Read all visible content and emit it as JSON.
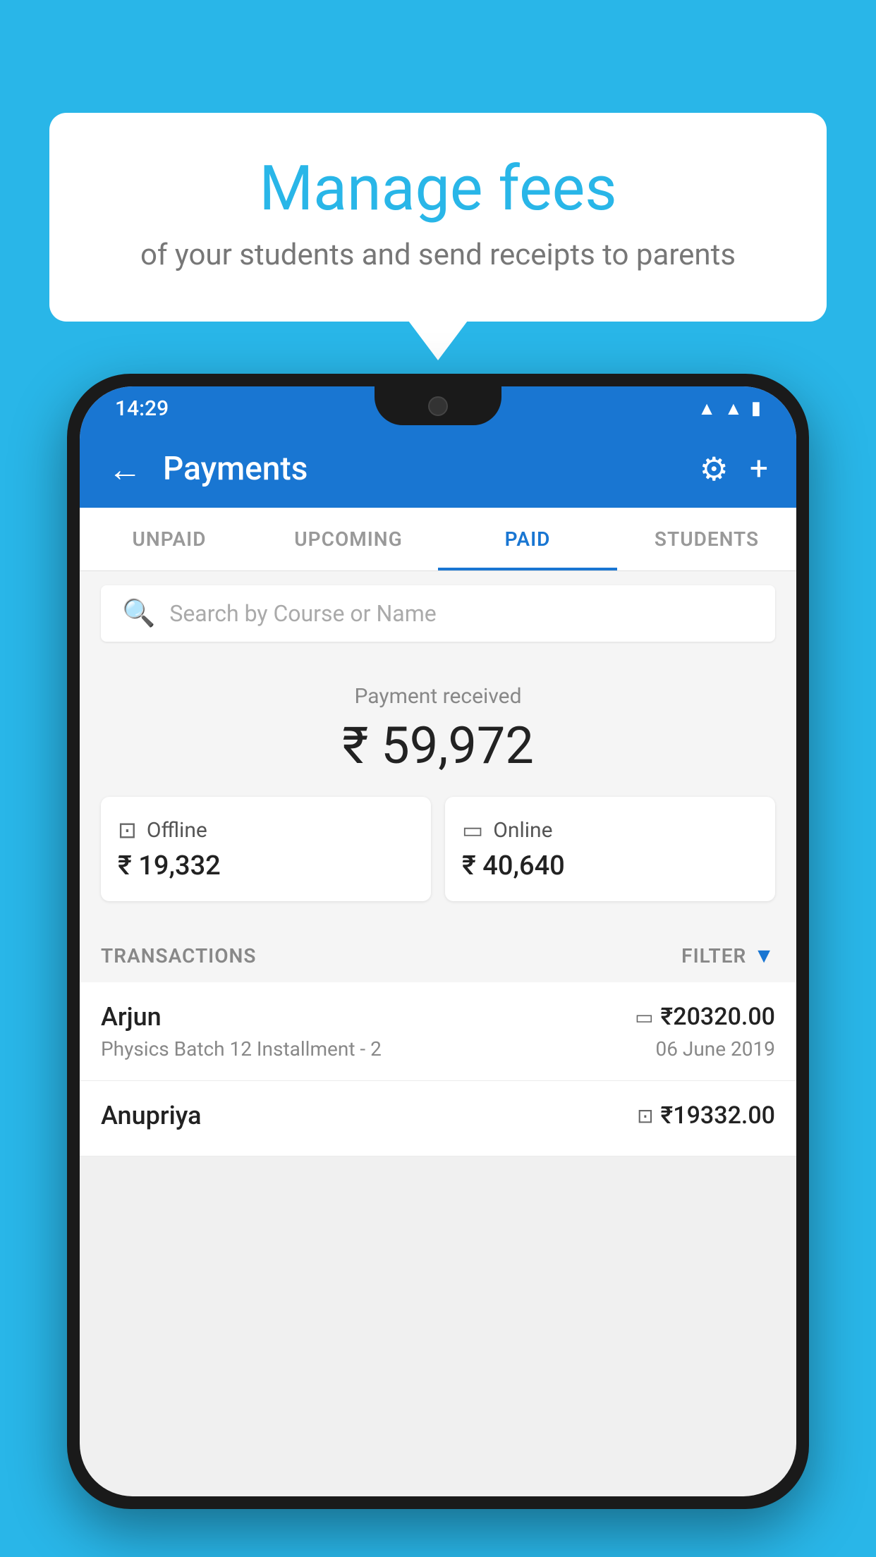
{
  "background_color": "#29B6E8",
  "bubble": {
    "title": "Manage fees",
    "subtitle": "of your students and send receipts to parents"
  },
  "status_bar": {
    "time": "14:29",
    "icons": [
      "wifi",
      "signal",
      "battery"
    ]
  },
  "app_bar": {
    "title": "Payments",
    "back_label": "←",
    "gear_label": "⚙",
    "plus_label": "+"
  },
  "tabs": [
    {
      "label": "UNPAID",
      "active": false
    },
    {
      "label": "UPCOMING",
      "active": false
    },
    {
      "label": "PAID",
      "active": true
    },
    {
      "label": "STUDENTS",
      "active": false
    }
  ],
  "search": {
    "placeholder": "Search by Course or Name"
  },
  "payment_summary": {
    "label": "Payment received",
    "total": "₹ 59,972",
    "offline": {
      "type": "Offline",
      "amount": "₹ 19,332"
    },
    "online": {
      "type": "Online",
      "amount": "₹ 40,640"
    }
  },
  "transactions": {
    "label": "TRANSACTIONS",
    "filter_label": "FILTER",
    "rows": [
      {
        "name": "Arjun",
        "course": "Physics Batch 12 Installment - 2",
        "amount": "₹20320.00",
        "date": "06 June 2019",
        "icon": "card"
      },
      {
        "name": "Anupriya",
        "course": "",
        "amount": "₹19332.00",
        "date": "",
        "icon": "cash"
      }
    ]
  }
}
